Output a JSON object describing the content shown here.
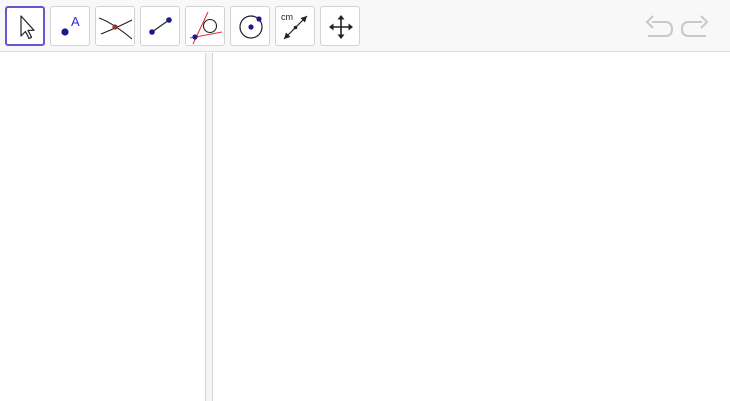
{
  "toolbar": {
    "tools": [
      {
        "id": "move",
        "icon": "arrow-pointer-icon",
        "active": true
      },
      {
        "id": "point",
        "icon": "point-icon",
        "label": "A"
      },
      {
        "id": "intersect",
        "icon": "intersect-icon"
      },
      {
        "id": "segment",
        "icon": "segment-icon"
      },
      {
        "id": "tangent",
        "icon": "tangent-icon"
      },
      {
        "id": "circle",
        "icon": "circle-center-point-icon"
      },
      {
        "id": "distance",
        "icon": "distance-icon",
        "label": "cm"
      },
      {
        "id": "move-graphics",
        "icon": "move-graphics-icon"
      }
    ],
    "undo_icon": "undo-icon",
    "redo_icon": "redo-icon"
  },
  "colors": {
    "active_border": "#6557d2",
    "point": "#1a1a8c",
    "intersection_point": "#993333",
    "tangent_line": "#e0333a",
    "label": "#2b2bd6"
  }
}
